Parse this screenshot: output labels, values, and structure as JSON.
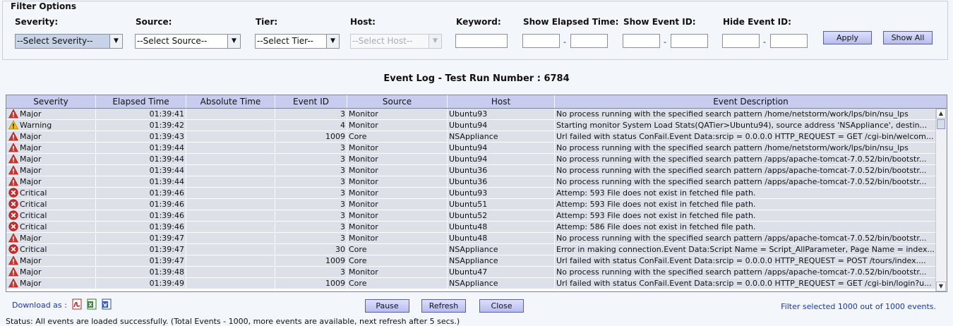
{
  "filter": {
    "legend": "Filter Options",
    "severity_label": "Severity:",
    "severity_value": "--Select Severity--",
    "source_label": "Source:",
    "source_value": "--Select Source--",
    "tier_label": "Tier:",
    "tier_value": "--Select Tier--",
    "host_label": "Host:",
    "host_value": "--Select Host--",
    "keyword_label": "Keyword:",
    "keyword_value": "",
    "elapsed_label": "Show Elapsed Time:",
    "elapsed_from": "",
    "elapsed_to": "",
    "eventid_label": "Show Event ID:",
    "eventid_from": "",
    "eventid_to": "",
    "hideid_label": "Hide Event ID:",
    "hideid_from": "",
    "hideid_to": "",
    "range_sep": "-",
    "apply_label": "Apply",
    "showall_label": "Show All"
  },
  "log_title": "Event Log - Test Run Number : 6784",
  "columns": [
    "Severity",
    "Elapsed Time",
    "Absolute Time",
    "Event ID",
    "Source",
    "Host",
    "Event Description"
  ],
  "rows": [
    {
      "severity": "Major",
      "icon": "major",
      "elapsed": "01:39:41",
      "absolute": "",
      "event_id": "3",
      "source": "Monitor",
      "host": "Ubuntu93",
      "desc": "No process running with the specified search pattern /home/netstorm/work/lps/bin/nsu_lps"
    },
    {
      "severity": "Warning",
      "icon": "warning",
      "elapsed": "01:39:42",
      "absolute": "",
      "event_id": "4",
      "source": "Monitor",
      "host": "Ubuntu94",
      "desc": "Starting monitor System Load Stats(QATier>Ubuntu94), source address 'NSAppliance',  destin..."
    },
    {
      "severity": "Major",
      "icon": "major",
      "elapsed": "01:39:43",
      "absolute": "",
      "event_id": "1009",
      "source": "Core",
      "host": "NSAppliance",
      "desc": "Url failed with status ConFail.Event Data:srcip = 0.0.0.0 HTTP_REQUEST = GET /cgi-bin/welcom..."
    },
    {
      "severity": "Major",
      "icon": "major",
      "elapsed": "01:39:44",
      "absolute": "",
      "event_id": "3",
      "source": "Monitor",
      "host": "Ubuntu94",
      "desc": "No process running with the specified search pattern /home/netstorm/work/lps/bin/nsu_lps"
    },
    {
      "severity": "Major",
      "icon": "major",
      "elapsed": "01:39:44",
      "absolute": "",
      "event_id": "3",
      "source": "Monitor",
      "host": "Ubuntu94",
      "desc": "No process running with the specified search pattern /apps/apache-tomcat-7.0.52/bin/bootstr..."
    },
    {
      "severity": "Major",
      "icon": "major",
      "elapsed": "01:39:44",
      "absolute": "",
      "event_id": "3",
      "source": "Monitor",
      "host": "Ubuntu36",
      "desc": "No process running with the specified search pattern /apps/apache-tomcat-7.0.52/bin/bootstr..."
    },
    {
      "severity": "Major",
      "icon": "major",
      "elapsed": "01:39:44",
      "absolute": "",
      "event_id": "3",
      "source": "Monitor",
      "host": "Ubuntu36",
      "desc": "No process running with the specified search pattern /apps/apache-tomcat-7.0.52/bin/bootstr..."
    },
    {
      "severity": "Critical",
      "icon": "critical",
      "elapsed": "01:39:46",
      "absolute": "",
      "event_id": "3",
      "source": "Monitor",
      "host": "Ubuntu93",
      "desc": "Attemp: 593 File does not exist in fetched file path."
    },
    {
      "severity": "Critical",
      "icon": "critical",
      "elapsed": "01:39:46",
      "absolute": "",
      "event_id": "3",
      "source": "Monitor",
      "host": "Ubuntu51",
      "desc": "Attemp: 593 File does not exist in fetched file path."
    },
    {
      "severity": "Critical",
      "icon": "critical",
      "elapsed": "01:39:46",
      "absolute": "",
      "event_id": "3",
      "source": "Monitor",
      "host": "Ubuntu52",
      "desc": "Attemp: 593 File does not exist in fetched file path."
    },
    {
      "severity": "Critical",
      "icon": "critical",
      "elapsed": "01:39:46",
      "absolute": "",
      "event_id": "3",
      "source": "Monitor",
      "host": "Ubuntu48",
      "desc": "Attemp: 586 File does not exist in fetched file path."
    },
    {
      "severity": "Major",
      "icon": "major",
      "elapsed": "01:39:47",
      "absolute": "",
      "event_id": "3",
      "source": "Monitor",
      "host": "Ubuntu48",
      "desc": "No process running with the specified search pattern /apps/apache-tomcat-7.0.52/bin/bootstr..."
    },
    {
      "severity": "Critical",
      "icon": "critical",
      "elapsed": "01:39:47",
      "absolute": "",
      "event_id": "30",
      "source": "Core",
      "host": "NSAppliance",
      "desc": "Error in making connection.Event Data:Script Name = Script_AllParameter, Page Name = index..."
    },
    {
      "severity": "Major",
      "icon": "major",
      "elapsed": "01:39:47",
      "absolute": "",
      "event_id": "1009",
      "source": "Core",
      "host": "NSAppliance",
      "desc": "Url failed with status ConFail.Event Data:srcip = 0.0.0.0 HTTP_REQUEST = POST /tours/index...."
    },
    {
      "severity": "Major",
      "icon": "major",
      "elapsed": "01:39:48",
      "absolute": "",
      "event_id": "3",
      "source": "Monitor",
      "host": "Ubuntu47",
      "desc": "No process running with the specified search pattern /apps/apache-tomcat-7.0.52/bin/bootstr..."
    },
    {
      "severity": "Major",
      "icon": "major",
      "elapsed": "01:39:49",
      "absolute": "",
      "event_id": "1009",
      "source": "Core",
      "host": "NSAppliance",
      "desc": "Url failed with status ConFail.Event Data:srcip = 0.0.0.0 HTTP_REQUEST = GET /cgi-bin/login?u..."
    }
  ],
  "footer": {
    "download_label": "Download as :",
    "download_icons": [
      "pdf-icon",
      "excel-icon",
      "word-icon"
    ],
    "pause_label": "Pause",
    "refresh_label": "Refresh",
    "close_label": "Close",
    "filter_info": "Filter selected 1000 out of 1000 events.",
    "status": "Status: All events are loaded successfully. (Total Events - 1000, more events are available, next refresh after 5 secs.)"
  },
  "colors": {
    "header_bg": "#c8cdef",
    "row_bg": "#dce1e9",
    "button_bg": "#b7bcf1",
    "link_blue": "#1a3aa8",
    "major_red": "#d8332b",
    "warning_yellow": "#f2c200",
    "critical_red": "#cf2a2a"
  }
}
